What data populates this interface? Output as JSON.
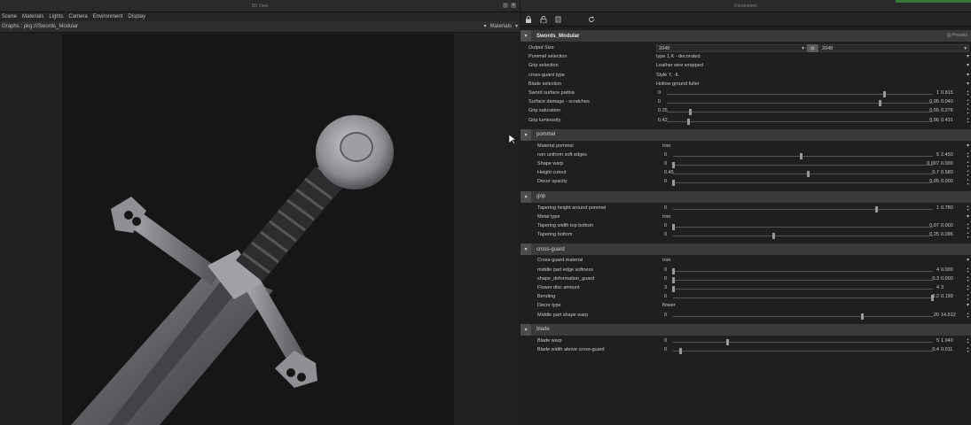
{
  "viewer": {
    "title": "3D View",
    "menu": [
      "Scene",
      "Materials",
      "Lights",
      "Camera",
      "Environment",
      "Display"
    ],
    "graph_label": "Graphs : pkg:///Swords_Modular",
    "materials_label": "Materials"
  },
  "params": {
    "title": "Parameters",
    "presets_label": "Presets",
    "graph_name": "Swords_Modular",
    "output_size": {
      "label": "Output Size",
      "w": "2048",
      "h": "2048"
    },
    "main_rows": [
      {
        "label": "Pommel selection",
        "type": "drop",
        "value": "type 1,K - decorated"
      },
      {
        "label": "Grip selection",
        "type": "drop",
        "value": "Leather wire wrapped"
      },
      {
        "label": "cross-guard type",
        "type": "drop",
        "value": "Style Y, -II."
      },
      {
        "label": "Blade selection",
        "type": "drop",
        "value": "Hollow ground fuller"
      },
      {
        "label": "Sword surface patina",
        "type": "slider",
        "min": "0",
        "max": "1",
        "value": "0.815",
        "pos": 0.815
      },
      {
        "label": "Surface damage - scratches",
        "type": "slider",
        "min": "0",
        "max": "0.05",
        "value": "0.040",
        "pos": 0.8
      },
      {
        "label": "Grip saturation",
        "type": "slider",
        "min": "0.25",
        "max": "0.55",
        "value": "0.276",
        "pos": 0.087
      },
      {
        "label": "Grip luminosity",
        "type": "slider",
        "min": "0.42",
        "max": "0.56",
        "value": "0.431",
        "pos": 0.079
      }
    ],
    "sections": [
      {
        "name": "pommel",
        "rows": [
          {
            "label": "Material pommel",
            "type": "drop",
            "value": "Iron"
          },
          {
            "label": "non uniform soft edges",
            "type": "slider",
            "min": "0",
            "max": "5",
            "value": "2.450",
            "pos": 0.49
          },
          {
            "label": "Shape warp",
            "type": "slider",
            "min": "0",
            "max": "0.007",
            "value": "0.000",
            "pos": 0.0
          },
          {
            "label": "Height cutout",
            "type": "slider",
            "min": "0.45",
            "max": "0.7",
            "value": "0.580",
            "pos": 0.52
          },
          {
            "label": "Decor opacity",
            "type": "slider",
            "min": "0",
            "max": "0.05",
            "value": "0.000",
            "pos": 0.0
          }
        ]
      },
      {
        "name": "grip",
        "rows": [
          {
            "label": "Tapering height around pommel",
            "type": "slider",
            "min": "0",
            "max": "1",
            "value": "0.780",
            "pos": 0.78
          },
          {
            "label": "Metal type",
            "type": "drop",
            "value": "Iron"
          },
          {
            "label": "Tapering width top bottom",
            "type": "slider",
            "min": "0",
            "max": "0.07",
            "value": "0.000",
            "pos": 0.0
          },
          {
            "label": "Tapering bottom",
            "type": "slider",
            "min": "0",
            "max": "0.25",
            "value": "0.096",
            "pos": 0.384
          }
        ]
      },
      {
        "name": "cross-guard",
        "rows": [
          {
            "label": "Cross-guard material",
            "type": "drop",
            "value": "Iron"
          },
          {
            "label": "middle part edge softness",
            "type": "slider",
            "min": "0",
            "max": "4",
            "value": "0.000",
            "pos": 0.0
          },
          {
            "label": "shape_deformation_guard",
            "type": "slider",
            "min": "0",
            "max": "0.3",
            "value": "0.000",
            "pos": 0.0
          },
          {
            "label": "Flower disc amount",
            "type": "slider",
            "min": "3",
            "max": "4",
            "value": "3",
            "pos": 0.0
          },
          {
            "label": "Bending",
            "type": "slider",
            "min": "0",
            "max": "0.2",
            "value": "0.199",
            "pos": 0.995
          },
          {
            "label": "Decor type",
            "type": "drop",
            "value": "flower"
          },
          {
            "label": "Middle part shape warp",
            "type": "slider",
            "min": "0",
            "max": "20",
            "value": "14.512",
            "pos": 0.7256
          }
        ]
      },
      {
        "name": "blade",
        "rows": [
          {
            "label": "Blade warp",
            "type": "slider",
            "min": "0",
            "max": "5",
            "value": "1.040",
            "pos": 0.208
          },
          {
            "label": "Blade width above cross-guard",
            "type": "slider",
            "min": "0",
            "max": "0.4",
            "value": "0.011",
            "pos": 0.0275
          }
        ]
      }
    ]
  }
}
